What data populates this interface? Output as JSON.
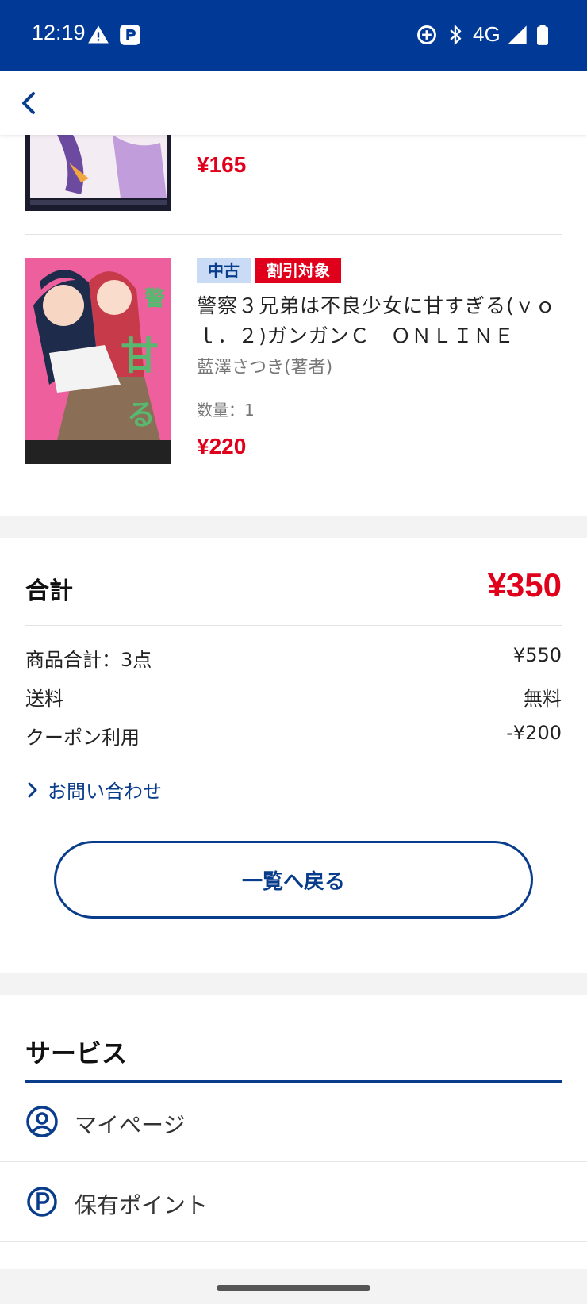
{
  "status_bar": {
    "time": "12:19",
    "network": "4G",
    "icons": [
      "warning-icon",
      "p-app-icon",
      "data-saver-icon",
      "bluetooth-icon",
      "signal-icon",
      "battery-icon"
    ]
  },
  "header": {
    "back_icon": "chevron-left-icon"
  },
  "items": [
    {
      "price": "¥165"
    },
    {
      "badge_used": "中古",
      "badge_sale": "割引対象",
      "title": "警察３兄弟は不良少女に甘すぎる(ｖｏｌ．２)ガンガンＣ　ＯＮＬＩＮＥ",
      "author": "藍澤さつき(著者)",
      "quantity": "数量：1",
      "price": "¥220"
    }
  ],
  "summary": {
    "total_label": "合計",
    "total_value": "¥350",
    "rows": [
      {
        "label": "商品合計：3点",
        "value": "¥550"
      },
      {
        "label": "送料",
        "value": "無料"
      },
      {
        "label": "クーポン利用",
        "value": "-¥200"
      }
    ],
    "contact_link": "お問い合わせ",
    "back_to_list": "一覧へ戻る"
  },
  "services": {
    "title": "サービス",
    "items": [
      {
        "label": "マイページ",
        "icon": "user-circle-icon"
      },
      {
        "label": "保有ポイント",
        "icon": "points-icon"
      }
    ]
  },
  "colors": {
    "brand_blue": "#003a96",
    "price_red": "#e0001b"
  }
}
